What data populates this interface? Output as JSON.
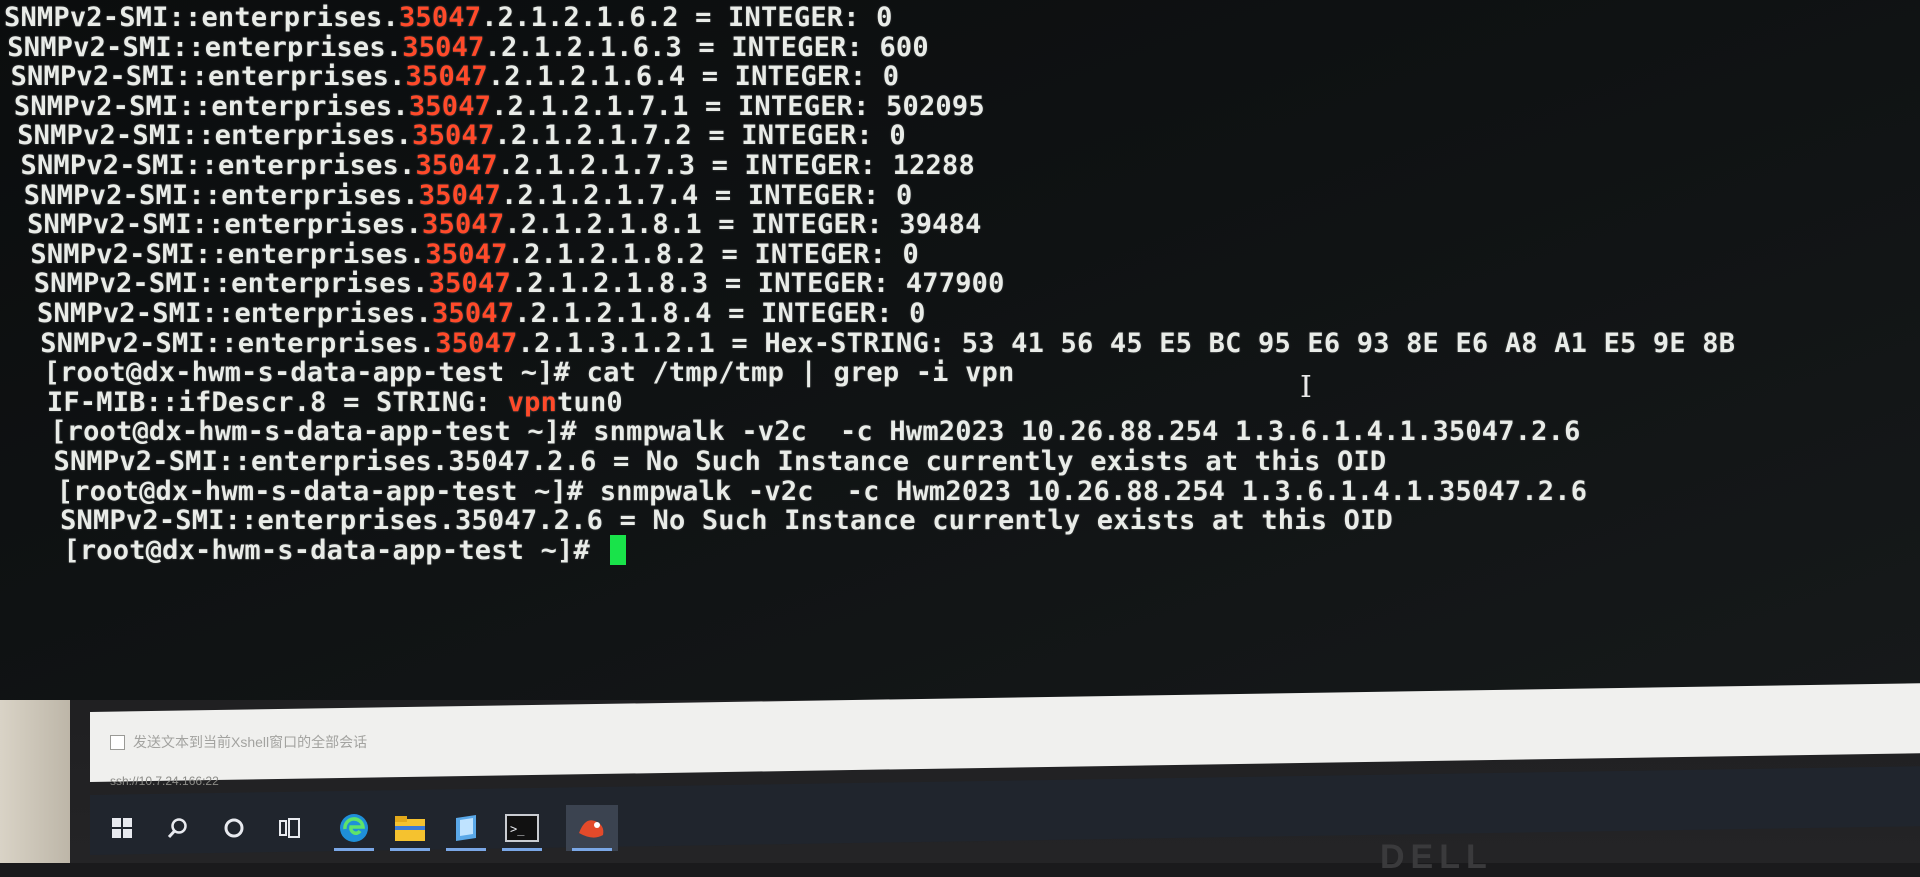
{
  "terminal": {
    "lines": [
      {
        "pre": "SNMPv2-SMI::enterprises.",
        "hl": "35047",
        "post": ".2.1.2.1.6.2 = INTEGER: 0"
      },
      {
        "pre": "SNMPv2-SMI::enterprises.",
        "hl": "35047",
        "post": ".2.1.2.1.6.3 = INTEGER: 600"
      },
      {
        "pre": "SNMPv2-SMI::enterprises.",
        "hl": "35047",
        "post": ".2.1.2.1.6.4 = INTEGER: 0"
      },
      {
        "pre": "SNMPv2-SMI::enterprises.",
        "hl": "35047",
        "post": ".2.1.2.1.7.1 = INTEGER: 502095"
      },
      {
        "pre": "SNMPv2-SMI::enterprises.",
        "hl": "35047",
        "post": ".2.1.2.1.7.2 = INTEGER: 0"
      },
      {
        "pre": "SNMPv2-SMI::enterprises.",
        "hl": "35047",
        "post": ".2.1.2.1.7.3 = INTEGER: 12288"
      },
      {
        "pre": "SNMPv2-SMI::enterprises.",
        "hl": "35047",
        "post": ".2.1.2.1.7.4 = INTEGER: 0"
      },
      {
        "pre": "SNMPv2-SMI::enterprises.",
        "hl": "35047",
        "post": ".2.1.2.1.8.1 = INTEGER: 39484"
      },
      {
        "pre": "SNMPv2-SMI::enterprises.",
        "hl": "35047",
        "post": ".2.1.2.1.8.2 = INTEGER: 0"
      },
      {
        "pre": "SNMPv2-SMI::enterprises.",
        "hl": "35047",
        "post": ".2.1.2.1.8.3 = INTEGER: 477900"
      },
      {
        "pre": "SNMPv2-SMI::enterprises.",
        "hl": "35047",
        "post": ".2.1.2.1.8.4 = INTEGER: 0"
      },
      {
        "pre": "SNMPv2-SMI::enterprises.",
        "hl": "35047",
        "post": ".2.1.3.1.2.1 = Hex-STRING: 53 41 56 45 E5 BC 95 E6 93 8E E6 A8 A1 E5 9E 8B"
      },
      {
        "pre": "[root@dx-hwm-s-data-app-test ~]# cat /tmp/tmp | grep -i vpn",
        "hl": "",
        "post": ""
      },
      {
        "pre": "IF-MIB::ifDescr.8 = STRING: ",
        "hl": "vpn",
        "post": "tun0"
      },
      {
        "pre": "[root@dx-hwm-s-data-app-test ~]# snmpwalk -v2c  -c Hwm2023 10.26.88.254 1.3.6.1.4.1.35047.2.6",
        "hl": "",
        "post": ""
      },
      {
        "pre": "SNMPv2-SMI::enterprises.35047.2.6 = No Such Instance currently exists at this OID",
        "hl": "",
        "post": ""
      },
      {
        "pre": "[root@dx-hwm-s-data-app-test ~]# snmpwalk -v2c  -c Hwm2023 10.26.88.254 1.3.6.1.4.1.35047.2.6",
        "hl": "",
        "post": ""
      },
      {
        "pre": "SNMPv2-SMI::enterprises.35047.2.6 = No Such Instance currently exists at this OID",
        "hl": "",
        "post": ""
      },
      {
        "pre": "[root@dx-hwm-s-data-app-test ~]# ",
        "hl": "",
        "post": ""
      }
    ],
    "highlight_color": "#ff4a2a",
    "cursor_color": "#19e34a"
  },
  "statusbar": {
    "send_label": "发送文本到当前Xshell窗口的全部会话",
    "ssh_address": "ssh://10.7.24.166:22"
  },
  "taskbar": {
    "icons": [
      "windows-start-icon",
      "search-icon",
      "cortana-icon",
      "task-view-icon",
      "edge-icon",
      "file-explorer-icon",
      "notepad-icon",
      "terminal-icon",
      "xshell-icon"
    ]
  },
  "brand": "DELL"
}
